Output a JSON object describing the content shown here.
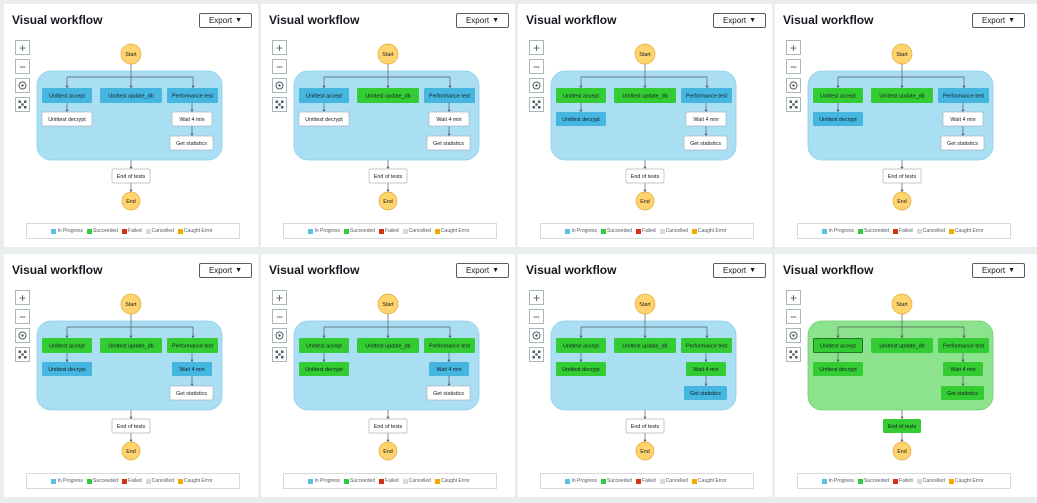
{
  "panel_title": "Visual workflow",
  "export_label": "Export",
  "export_caret": "▼",
  "zoom_in_symbol": "+",
  "zoom_out_symbol": "−",
  "colors": {
    "in_progress": "#5bc0de",
    "in_progress_node": "#45b6e0",
    "succeeded": "#2ecc40",
    "succeeded_node": "#33cc33",
    "failed": "#d13212",
    "cancelled": "#d5dbdb",
    "caught_error": "#f2a900",
    "parallel_bg_progress": "#a9def3",
    "parallel_bg_done": "#8de38d",
    "start_end": "#ffd36e",
    "pending": "#ffffff"
  },
  "legend": [
    {
      "label": "In Progress",
      "color": "#5bc0de"
    },
    {
      "label": "Succeeded",
      "color": "#2ecc40"
    },
    {
      "label": "Failed",
      "color": "#d13212"
    },
    {
      "label": "Cancelled",
      "color": "#d5dbdb"
    },
    {
      "label": "Caught Error",
      "color": "#f2a900"
    }
  ],
  "labels": {
    "start": "Start",
    "end": "End",
    "unittest_accept": "Unittest accept",
    "unittest_update_db": "Unittest update_db",
    "performance_test": "Performance test",
    "unittest_decrypt": "Unittest decrypt",
    "wait_4_min": "Wait 4 min",
    "get_statistics": "Get statistics",
    "end_of_tests": "End of tests"
  },
  "panels": [
    {
      "parallel": "progress",
      "states": {
        "unittest_accept": "progress",
        "unittest_update_db": "progress",
        "performance_test": "progress",
        "unittest_decrypt": "pending",
        "wait_4_min": "pending",
        "get_statistics": "pending",
        "end_of_tests": "pending"
      }
    },
    {
      "parallel": "progress",
      "states": {
        "unittest_accept": "progress",
        "unittest_update_db": "succeeded",
        "performance_test": "progress",
        "unittest_decrypt": "pending",
        "wait_4_min": "pending",
        "get_statistics": "pending",
        "end_of_tests": "pending"
      }
    },
    {
      "parallel": "progress",
      "states": {
        "unittest_accept": "succeeded",
        "unittest_update_db": "succeeded",
        "performance_test": "progress",
        "unittest_decrypt": "progress",
        "wait_4_min": "pending",
        "get_statistics": "pending",
        "end_of_tests": "pending"
      }
    },
    {
      "parallel": "progress",
      "states": {
        "unittest_accept": "succeeded",
        "unittest_update_db": "succeeded",
        "performance_test": "progress",
        "unittest_decrypt": "progress",
        "wait_4_min": "pending",
        "get_statistics": "pending",
        "end_of_tests": "pending"
      }
    },
    {
      "parallel": "progress",
      "states": {
        "unittest_accept": "succeeded",
        "unittest_update_db": "succeeded",
        "performance_test": "succeeded",
        "unittest_decrypt": "progress",
        "wait_4_min": "progress",
        "get_statistics": "pending",
        "end_of_tests": "pending"
      }
    },
    {
      "parallel": "progress",
      "states": {
        "unittest_accept": "succeeded",
        "unittest_update_db": "succeeded",
        "performance_test": "succeeded",
        "unittest_decrypt": "succeeded",
        "wait_4_min": "progress",
        "get_statistics": "pending",
        "end_of_tests": "pending"
      }
    },
    {
      "parallel": "progress",
      "states": {
        "unittest_accept": "succeeded",
        "unittest_update_db": "succeeded",
        "performance_test": "succeeded",
        "unittest_decrypt": "succeeded",
        "wait_4_min": "succeeded",
        "get_statistics": "progress",
        "end_of_tests": "pending"
      }
    },
    {
      "parallel": "done",
      "states": {
        "unittest_accept": "succeeded",
        "unittest_update_db": "succeeded",
        "performance_test": "succeeded",
        "unittest_decrypt": "succeeded",
        "wait_4_min": "succeeded",
        "get_statistics": "succeeded",
        "end_of_tests": "succeeded"
      }
    }
  ]
}
